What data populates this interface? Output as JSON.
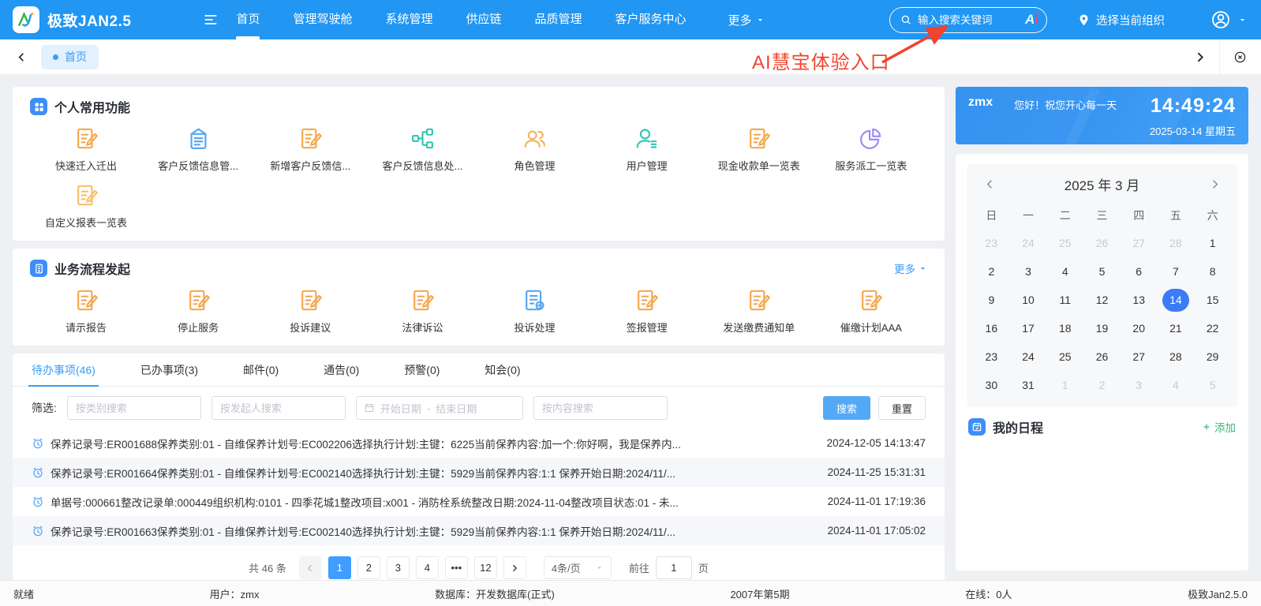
{
  "navbar": {
    "brand": "极致JAN2.5",
    "menu": [
      "首页",
      "管理驾驶舱",
      "系统管理",
      "供应链",
      "品质管理",
      "客户服务中心"
    ],
    "more_label": "更多",
    "search_placeholder": "输入搜索关键词",
    "ai_badge_a": "A",
    "ai_badge_i": "i",
    "org_label": "选择当前组织"
  },
  "tabbar": {
    "tab_label": "首页"
  },
  "annotation": {
    "text": "AI慧宝体验入口"
  },
  "personal": {
    "title": "个人常用功能",
    "items": [
      {
        "label": "快速迁入迁出",
        "icon": "doc-edit",
        "color": "#f6a84c"
      },
      {
        "label": "客户反馈信息管...",
        "icon": "clipboard",
        "color": "#5aa7f0"
      },
      {
        "label": "新增客户反馈信...",
        "icon": "doc-edit",
        "color": "#f6a84c"
      },
      {
        "label": "客户反馈信息处...",
        "icon": "flow",
        "color": "#35c7b4"
      },
      {
        "label": "角色管理",
        "icon": "people",
        "color": "#f6b45c"
      },
      {
        "label": "用户管理",
        "icon": "person",
        "color": "#35c7b4"
      },
      {
        "label": "现金收款单一览表",
        "icon": "doc-edit",
        "color": "#f6a84c"
      },
      {
        "label": "服务派工一览表",
        "icon": "pie",
        "color": "#a08af5"
      },
      {
        "label": "自定义报表一览表",
        "icon": "doc-edit",
        "color": "#f6c06a"
      }
    ]
  },
  "process": {
    "title": "业务流程发起",
    "more_label": "更多",
    "items": [
      {
        "label": "请示报告",
        "icon": "doc-edit",
        "color": "#f6a84c"
      },
      {
        "label": "停止服务",
        "icon": "doc-edit",
        "color": "#f6a84c"
      },
      {
        "label": "投诉建议",
        "icon": "doc-edit",
        "color": "#f6a84c"
      },
      {
        "label": "法律诉讼",
        "icon": "doc-edit",
        "color": "#f6a84c"
      },
      {
        "label": "投诉处理",
        "icon": "doc-list",
        "color": "#5aa7f0"
      },
      {
        "label": "签报管理",
        "icon": "doc-edit",
        "color": "#f6a84c"
      },
      {
        "label": "发送缴费通知单",
        "icon": "doc-edit",
        "color": "#f6a84c"
      },
      {
        "label": "催缴计划AAA",
        "icon": "doc-edit",
        "color": "#f6a84c"
      }
    ]
  },
  "tasks": {
    "tabs": [
      {
        "label": "待办事项(46)",
        "active": true
      },
      {
        "label": "已办事项(3)",
        "active": false
      },
      {
        "label": "邮件(0)",
        "active": false
      },
      {
        "label": "通告(0)",
        "active": false
      },
      {
        "label": "预警(0)",
        "active": false
      },
      {
        "label": "知会(0)",
        "active": false
      }
    ],
    "filter": {
      "label": "筛选:",
      "category_placeholder": "按类别搜索",
      "initiator_placeholder": "按发起人搜索",
      "date_start": "开始日期",
      "date_separator": "-",
      "date_end": "结束日期",
      "content_placeholder": "按内容搜索",
      "search_label": "搜索",
      "reset_label": "重置"
    },
    "items": [
      {
        "text": "保养记录号:ER001688保养类别:01 - 自维保养计划号:EC002206选择执行计划:主键：6225当前保养内容:加一个:你好啊，我是保养内...",
        "time": "2024-12-05 14:13:47"
      },
      {
        "text": "保养记录号:ER001664保养类别:01 - 自维保养计划号:EC002140选择执行计划:主键：5929当前保养内容:1:1 保养开始日期:2024/11/...",
        "time": "2024-11-25 15:31:31"
      },
      {
        "text": "单据号:000661整改记录单:000449组织机构:0101 - 四季花城1整改项目:x001 - 消防栓系统整改日期:2024-11-04整改项目状态:01 - 未...",
        "time": "2024-11-01 17:19:36"
      },
      {
        "text": "保养记录号:ER001663保养类别:01 - 自维保养计划号:EC002140选择执行计划:主键：5929当前保养内容:1:1 保养开始日期:2024/11/...",
        "time": "2024-11-01 17:05:02"
      }
    ],
    "pagination": {
      "total": "共 46 条",
      "pages": [
        "1",
        "2",
        "3",
        "4",
        "•••",
        "12"
      ],
      "active_page": "1",
      "page_size": "4条/页",
      "goto_label": "前往",
      "goto_value": "1",
      "goto_suffix": "页"
    }
  },
  "widget": {
    "user": "zmx",
    "greeting": "您好！祝您开心每一天",
    "time": "14:49:24",
    "date": "2025-03-14 星期五"
  },
  "calendar": {
    "title": "2025 年 3 月",
    "weekdays": [
      "日",
      "一",
      "二",
      "三",
      "四",
      "五",
      "六"
    ],
    "weeks": [
      [
        {
          "d": "23",
          "muted": true
        },
        {
          "d": "24",
          "muted": true
        },
        {
          "d": "25",
          "muted": true
        },
        {
          "d": "26",
          "muted": true
        },
        {
          "d": "27",
          "muted": true
        },
        {
          "d": "28",
          "muted": true
        },
        {
          "d": "1"
        }
      ],
      [
        {
          "d": "2"
        },
        {
          "d": "3"
        },
        {
          "d": "4"
        },
        {
          "d": "5"
        },
        {
          "d": "6"
        },
        {
          "d": "7"
        },
        {
          "d": "8"
        }
      ],
      [
        {
          "d": "9"
        },
        {
          "d": "10"
        },
        {
          "d": "11"
        },
        {
          "d": "12"
        },
        {
          "d": "13"
        },
        {
          "d": "14",
          "selected": true
        },
        {
          "d": "15"
        }
      ],
      [
        {
          "d": "16"
        },
        {
          "d": "17"
        },
        {
          "d": "18"
        },
        {
          "d": "19"
        },
        {
          "d": "20"
        },
        {
          "d": "21"
        },
        {
          "d": "22"
        }
      ],
      [
        {
          "d": "23"
        },
        {
          "d": "24"
        },
        {
          "d": "25"
        },
        {
          "d": "26"
        },
        {
          "d": "27"
        },
        {
          "d": "28"
        },
        {
          "d": "29"
        }
      ],
      [
        {
          "d": "30"
        },
        {
          "d": "31"
        },
        {
          "d": "1",
          "muted": true
        },
        {
          "d": "2",
          "muted": true
        },
        {
          "d": "3",
          "muted": true
        },
        {
          "d": "4",
          "muted": true
        },
        {
          "d": "5",
          "muted": true
        }
      ]
    ]
  },
  "schedule": {
    "title": "我的日程",
    "add_label": "添加"
  },
  "statusbar": {
    "items": [
      "就绪",
      "用户：zmx",
      "数据库：开发数据库(正式)",
      "2007年第5期",
      "在线：0人",
      "极致Jan2.5.0"
    ]
  },
  "colors": {
    "primary": "#2196f3",
    "link_blue": "#3d9cf3",
    "annotation_red": "#f2432e",
    "selected_day_blue": "#3a7bf6",
    "add_green": "#3eb57c",
    "icon_orange": "#f6a84c",
    "icon_teal": "#35c7b4",
    "icon_purple": "#a08af5"
  }
}
